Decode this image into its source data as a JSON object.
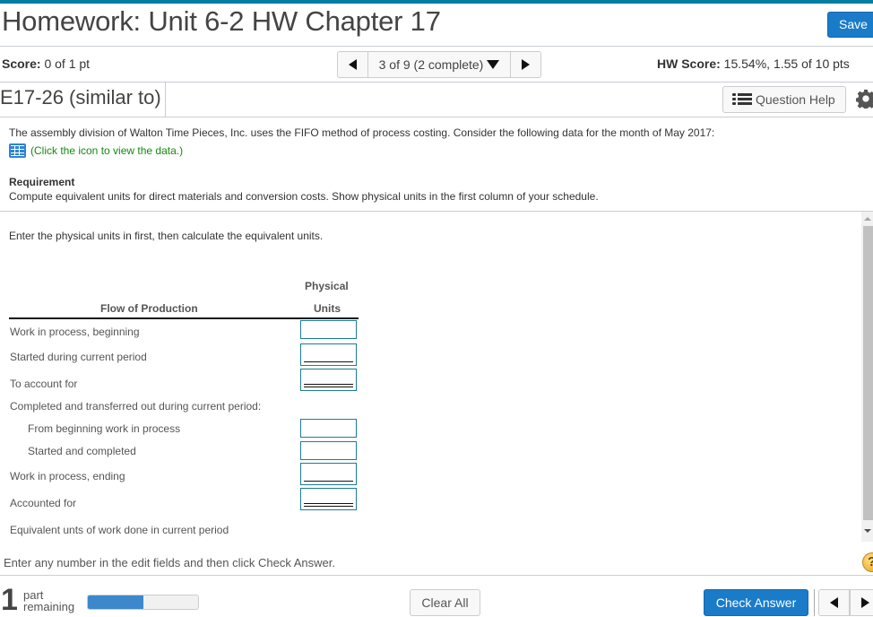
{
  "header": {
    "title": "Homework: Unit 6-2 HW Chapter 17",
    "save_label": "Save",
    "score_label": "Score:",
    "score_value": " 0 of 1 pt",
    "nav_position": "3 of 9 (2 complete)",
    "hw_score_label": "HW Score:",
    "hw_score_value": " 15.54%, 1.55 of 10 pts"
  },
  "question": {
    "id": "E17-26 (similar to)",
    "help_label": "Question Help",
    "intro": "The assembly division of Walton Time Pieces, Inc. uses the FIFO method of process costing. Consider the following data for the month of May 2017:",
    "data_link": "(Click the icon to view the data.)",
    "requirement_title": "Requirement",
    "requirement_text": "Compute equivalent units for direct materials and conversion costs. Show physical units in the first column of your schedule.",
    "instruction": "Enter the physical units in first, then calculate the equivalent units."
  },
  "table": {
    "header_physical": "Physical",
    "header_flow": "Flow of Production",
    "header_units": "Units",
    "rows": [
      {
        "label": "Work in process, beginning",
        "value": ""
      },
      {
        "label": "Started during current period",
        "value": ""
      },
      {
        "label": "To account for",
        "value": ""
      },
      {
        "label": "Completed and transferred out during current period:"
      },
      {
        "label": "From beginning work in process",
        "value": ""
      },
      {
        "label": "Started and completed",
        "value": ""
      },
      {
        "label": "Work in process, ending",
        "value": ""
      },
      {
        "label": "Accounted for",
        "value": ""
      },
      {
        "label": "Equivalent unts of work done in current period"
      }
    ]
  },
  "footer": {
    "message": "Enter any number in the edit fields and then click Check Answer.",
    "parts_count": "1",
    "parts_word1": "part",
    "parts_word2": "remaining",
    "progress_fraction": 0.5,
    "clear_label": "Clear All",
    "check_label": "Check Answer",
    "help_glyph": "?"
  },
  "colors": {
    "accent_blue": "#1a7bc9",
    "topbar": "#007fa3",
    "input_border": "#1a7d93",
    "link_green": "#118a11"
  }
}
